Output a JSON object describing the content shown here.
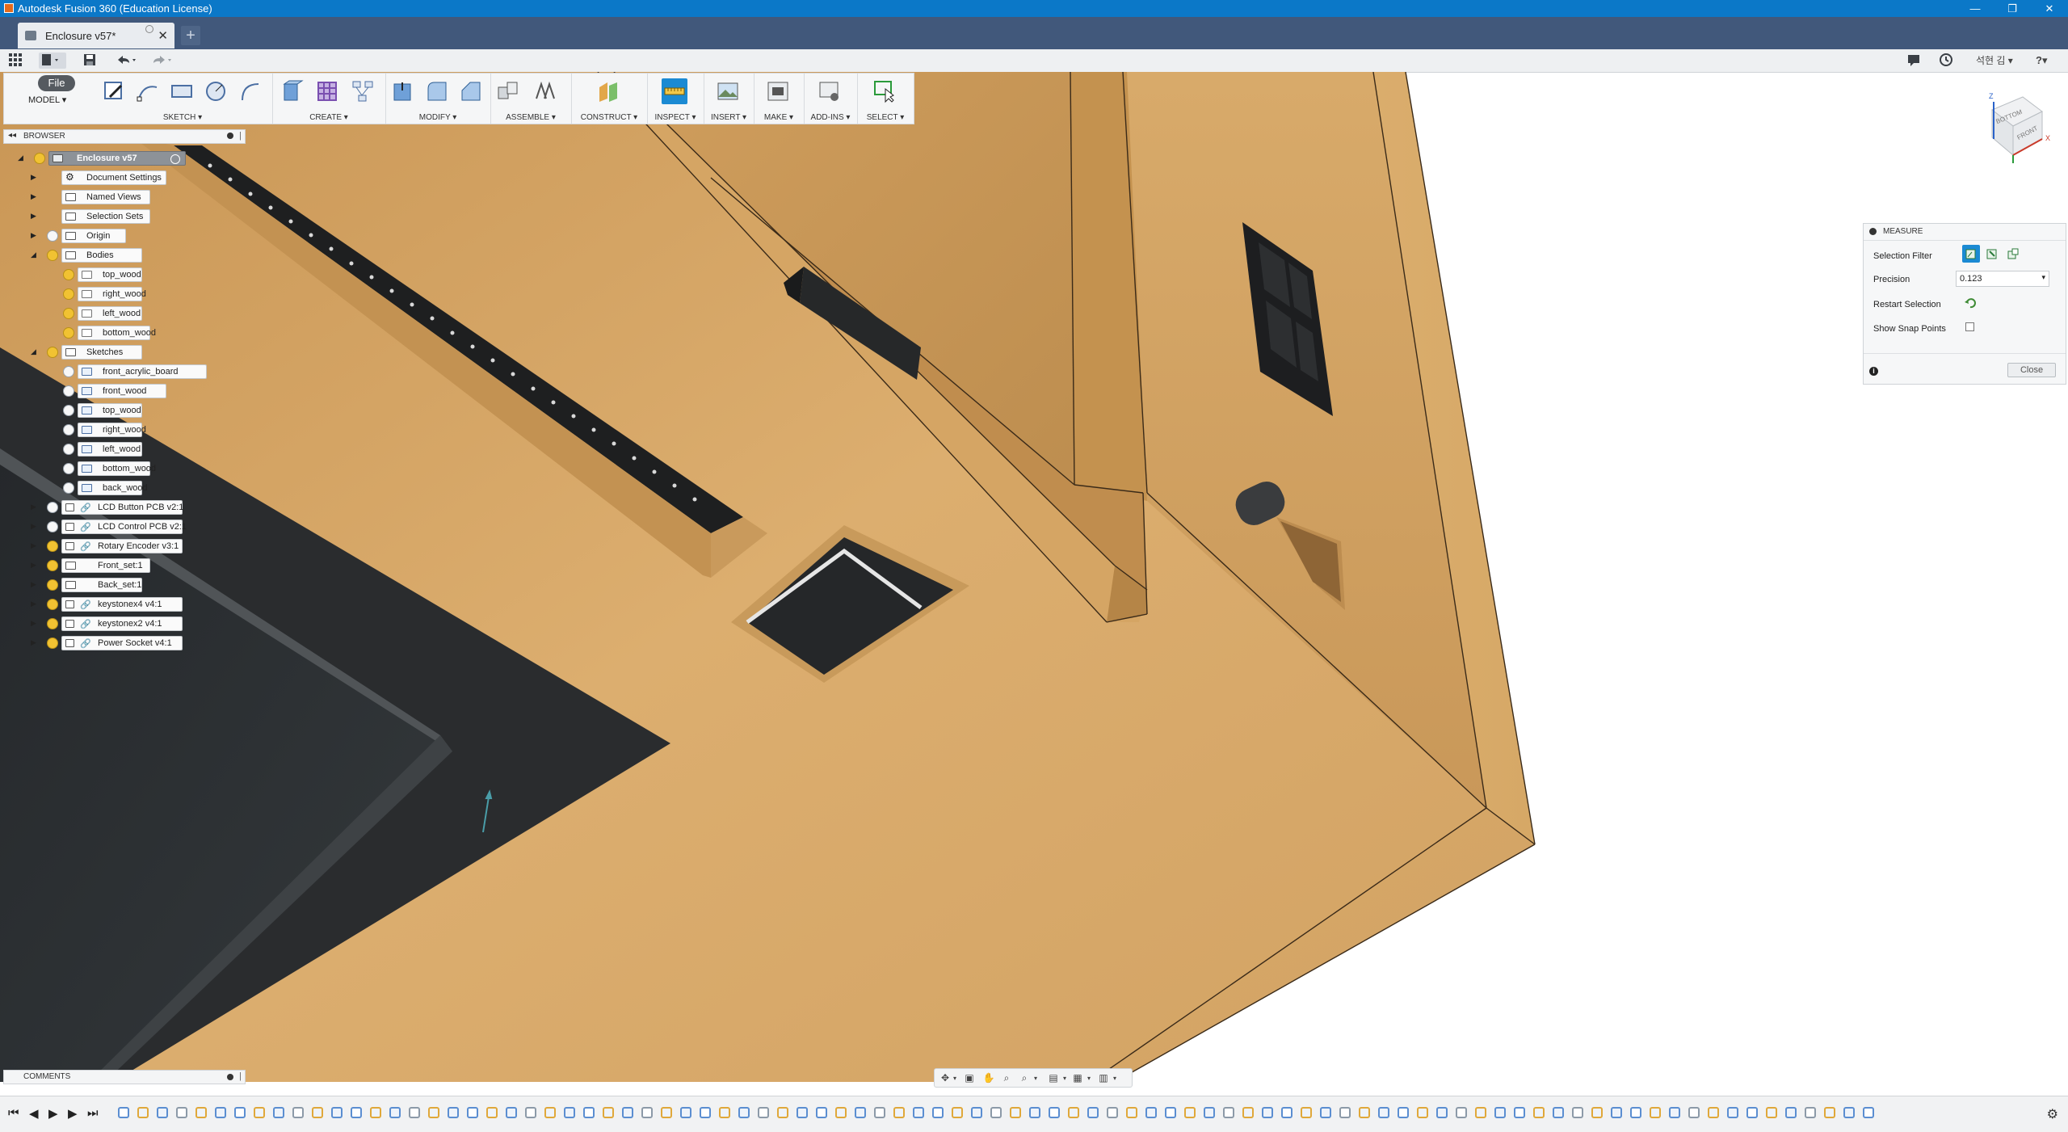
{
  "window": {
    "title": "Autodesk Fusion 360 (Education License)",
    "controls": [
      "—",
      "❐",
      "✕"
    ]
  },
  "tab": {
    "label": "Enclosure v57*",
    "close": "✕",
    "new_tab": "+"
  },
  "quickaccess": {
    "user": "석현 김 ▾",
    "help": "?▾"
  },
  "toolbar": {
    "file": "File",
    "workspace": "MODEL ▾",
    "groups": [
      {
        "label": "SKETCH ▾"
      },
      {
        "label": "CREATE ▾"
      },
      {
        "label": "MODIFY ▾"
      },
      {
        "label": "ASSEMBLE ▾"
      },
      {
        "label": "CONSTRUCT ▾"
      },
      {
        "label": "INSPECT ▾"
      },
      {
        "label": "INSERT ▾"
      },
      {
        "label": "MAKE ▾"
      },
      {
        "label": "ADD-INS ▾"
      },
      {
        "label": "SELECT ▾"
      }
    ]
  },
  "browser": {
    "title": "BROWSER",
    "collapse": "◂◂",
    "root": "Enclosure v57",
    "items": [
      {
        "label": "Document Settings"
      },
      {
        "label": "Named Views"
      },
      {
        "label": "Selection Sets"
      },
      {
        "label": "Origin"
      },
      {
        "label": "Bodies"
      },
      {
        "label": "top_wood"
      },
      {
        "label": "right_wood"
      },
      {
        "label": "left_wood"
      },
      {
        "label": "bottom_wood"
      },
      {
        "label": "Sketches"
      },
      {
        "label": "front_acrylic_board"
      },
      {
        "label": "front_wood"
      },
      {
        "label": "top_wood"
      },
      {
        "label": "right_wood"
      },
      {
        "label": "left_wood"
      },
      {
        "label": "bottom_wood"
      },
      {
        "label": "back_wood"
      },
      {
        "label": "LCD Button PCB v2:1"
      },
      {
        "label": "LCD Control PCB v2:1"
      },
      {
        "label": "Rotary Encoder v3:1"
      },
      {
        "label": "Front_set:1"
      },
      {
        "label": "Back_set:1"
      },
      {
        "label": "keystonex4 v4:1"
      },
      {
        "label": "keystonex2 v4:1"
      },
      {
        "label": "Power Socket v4:1"
      }
    ]
  },
  "measure": {
    "title": "MEASURE",
    "selection_filter": "Selection Filter",
    "precision_label": "Precision",
    "precision_value": "0.123",
    "restart_selection": "Restart Selection",
    "show_snap_points": "Show Snap Points",
    "close": "Close",
    "info": "i"
  },
  "comments": {
    "title": "COMMENTS"
  },
  "viewcube": {
    "front": "FRONT",
    "bottom": "BOTTOM",
    "axis_z": "Z",
    "axis_x": "X"
  },
  "colors": {
    "titlebar": "#0b78c8",
    "tabbar": "#41587b",
    "wood": "#d9a866",
    "panel_dark": "#2b2e31",
    "accent": "#1b8ad3"
  }
}
